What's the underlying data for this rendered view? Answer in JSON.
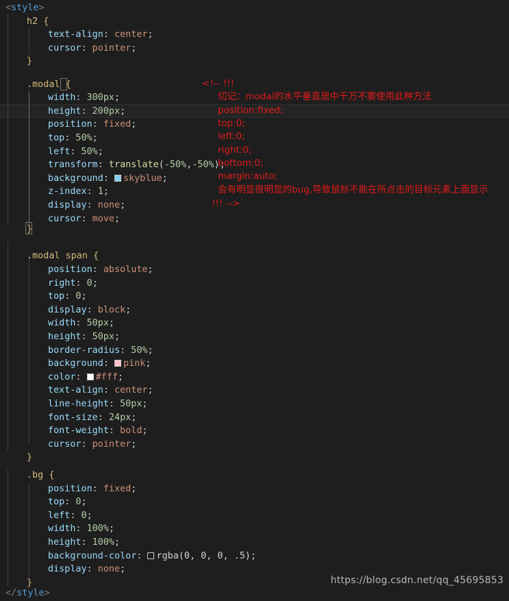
{
  "editor": {
    "language": "css",
    "theme": "dark-plus",
    "background": "#1e1e1e",
    "current_line_background": "#242424"
  },
  "colors": {
    "tag": "#569cd6",
    "punctuation": "#808080",
    "selector": "#d7ba7d",
    "property": "#9cdcfe",
    "value": "#ce9178",
    "number": "#b5cea8",
    "function": "#dcdcaa",
    "comment_red": "#e01b1b",
    "watermark": "#b9b9b9",
    "swatch_skyblue": "#87ceeb",
    "swatch_pink": "#ffc0cb",
    "swatch_white": "#ffffff",
    "swatch_rgba": "transparent"
  },
  "code": {
    "open_tag": {
      "lt": "<",
      "name": "style",
      "gt": ">"
    },
    "close_tag": {
      "lt": "</",
      "name": "style",
      "gt": ">"
    },
    "rules": {
      "h2": {
        "selector": "h2",
        "open_brace": "{",
        "close_brace": "}",
        "declarations": [
          {
            "property": "text-align",
            "value": "center"
          },
          {
            "property": "cursor",
            "value": "pointer"
          }
        ]
      },
      "modal": {
        "selector": ".modal",
        "open_brace": "{",
        "close_brace": "}",
        "declarations": [
          {
            "property": "width",
            "value": "300px"
          },
          {
            "property": "height",
            "value": "200px"
          },
          {
            "property": "position",
            "value": "fixed"
          },
          {
            "property": "top",
            "value": "50%"
          },
          {
            "property": "left",
            "value": "50%"
          },
          {
            "property": "transform",
            "value": "translate(-50%,-50%)"
          },
          {
            "property": "background",
            "value": "skyblue",
            "swatch": "#87ceeb"
          },
          {
            "property": "z-index",
            "value": "1"
          },
          {
            "property": "display",
            "value": "none"
          },
          {
            "property": "cursor",
            "value": "move"
          }
        ]
      },
      "modal_span": {
        "selector": ".modal span",
        "open_brace": "{",
        "close_brace": "}",
        "declarations": [
          {
            "property": "position",
            "value": "absolute"
          },
          {
            "property": "right",
            "value": "0"
          },
          {
            "property": "top",
            "value": "0"
          },
          {
            "property": "display",
            "value": "block"
          },
          {
            "property": "width",
            "value": "50px"
          },
          {
            "property": "height",
            "value": "50px"
          },
          {
            "property": "border-radius",
            "value": "50%"
          },
          {
            "property": "background",
            "value": "pink",
            "swatch": "#ffc0cb"
          },
          {
            "property": "color",
            "value": "#fff",
            "swatch": "#ffffff"
          },
          {
            "property": "text-align",
            "value": "center"
          },
          {
            "property": "line-height",
            "value": "50px"
          },
          {
            "property": "font-size",
            "value": "24px"
          },
          {
            "property": "font-weight",
            "value": "bold"
          },
          {
            "property": "cursor",
            "value": "pointer"
          }
        ]
      },
      "bg": {
        "selector": ".bg",
        "open_brace": "{",
        "close_brace": "}",
        "declarations": [
          {
            "property": "position",
            "value": "fixed"
          },
          {
            "property": "top",
            "value": "0"
          },
          {
            "property": "left",
            "value": "0"
          },
          {
            "property": "width",
            "value": "100%"
          },
          {
            "property": "height",
            "value": "100%"
          },
          {
            "property": "background-color",
            "value": "rgba(0, 0, 0, .5)",
            "swatch": "transparent"
          },
          {
            "property": "display",
            "value": "none"
          }
        ]
      }
    }
  },
  "annotation": {
    "open": "<!-- !!!",
    "lines": [
      "切记：modal的水平垂直居中千万不要使用此种方法",
      "position:fixed;",
      "top:0;",
      "left:0;",
      "right:0;",
      "bottom:0;",
      "margin:auto;",
      "会有明显很明显的bug,导致鼠标不能在所点击的目标元素上面显示"
    ],
    "close": "!!! -->"
  },
  "watermark": {
    "text": "https://blog.csdn.net/qq_45695853"
  }
}
